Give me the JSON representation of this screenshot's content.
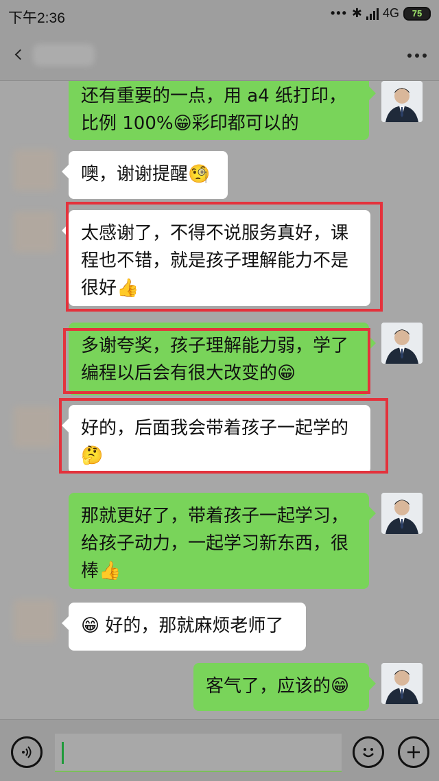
{
  "status_bar": {
    "time": "下午2:36",
    "dots": "•••",
    "network": "4G",
    "battery": "75"
  },
  "nav": {
    "back_icon": "chevron-left-icon",
    "more_icon": "more-icon"
  },
  "messages": [
    {
      "side": "right",
      "text": "还有重要的一点，用 a4 纸打印，比例 100%😁彩印都可以的"
    },
    {
      "side": "left",
      "text": "噢，谢谢提醒🧐"
    },
    {
      "side": "left",
      "text": "太感谢了，不得不说服务真好，课程也不错，就是孩子理解能力不是很好👍"
    },
    {
      "side": "right",
      "text": "多谢夸奖，孩子理解能力弱，学了编程以后会有很大改变的😁"
    },
    {
      "side": "left",
      "text": "好的，后面我会带着孩子一起学的🤔"
    },
    {
      "side": "right",
      "text": "那就更好了，带着孩子一起学习，给孩子动力，一起学习新东西，很棒👍"
    },
    {
      "side": "left",
      "text": "😁 好的，那就麻烦老师了"
    },
    {
      "side": "right",
      "text": "客气了，应该的😁"
    }
  ],
  "input_bar": {
    "voice_icon": "voice-icon",
    "emoji_icon": "emoji-icon",
    "plus_icon": "plus-icon"
  },
  "colors": {
    "highlight": "#e4323c",
    "right_bubble": "#79d45a",
    "left_bubble": "#ffffff"
  }
}
